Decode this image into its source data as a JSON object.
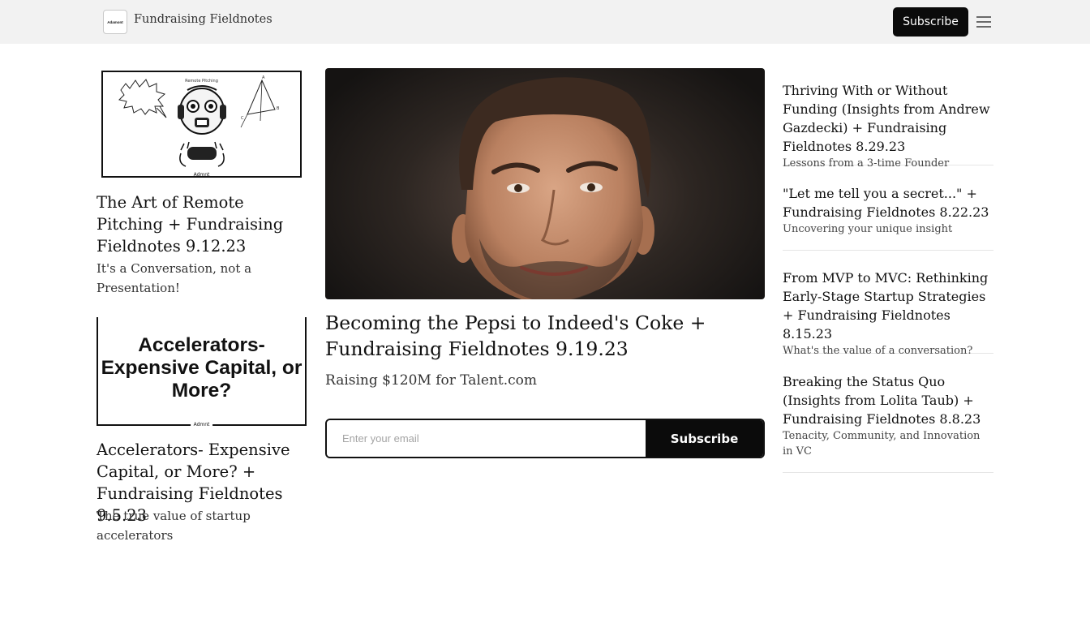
{
  "header": {
    "logo_text": "Adamont",
    "publication_name": "Fundraising Fieldnotes",
    "subscribe_label": "Subscribe"
  },
  "left_posts": [
    {
      "title": "The Art of Remote Pitching + Fundraising Fieldnotes 9.12.23",
      "subtitle": "It's a Conversation, not a Presentation!",
      "thumb_caption": "Remote Pitching",
      "thumb_brand": "Admnt"
    },
    {
      "title": "Accelerators- Expensive Capital, or More? + Fundraising Fieldnotes 9.5.23",
      "subtitle": "The true value of startup accelerators",
      "thumb_text": "Accelerators- Expensive Capital, or More?",
      "thumb_brand": "Admnt"
    }
  ],
  "featured": {
    "title": "Becoming the Pepsi to Indeed's Coke + Fundraising Fieldnotes 9.19.23",
    "subtitle": "Raising $120M for Talent.com",
    "email_placeholder": "Enter your email",
    "subscribe_label": "Subscribe"
  },
  "right_posts": [
    {
      "title": "Thriving With or Without Funding (Insights from Andrew Gazdecki) + Fundraising Fieldnotes 8.29.23",
      "subtitle": "Lessons from a 3-time Founder"
    },
    {
      "title": "\"Let me tell you a secret...\" + Fundraising Fieldnotes 8.22.23",
      "subtitle": "Uncovering your unique insight"
    },
    {
      "title": "From MVP to MVC: Rethinking Early-Stage Startup Strategies + Fundraising Fieldnotes 8.15.23",
      "subtitle": "What's the value of a conversation?"
    },
    {
      "title": "Breaking the Status Quo (Insights from Lolita Taub) + Fundraising Fieldnotes 8.8.23",
      "subtitle": "Tenacity, Community, and Innovation in VC"
    }
  ],
  "colors": {
    "header_bg": "#f2f2f2",
    "button_bg": "#0b0b0b",
    "divider": "#e5e5e5"
  }
}
